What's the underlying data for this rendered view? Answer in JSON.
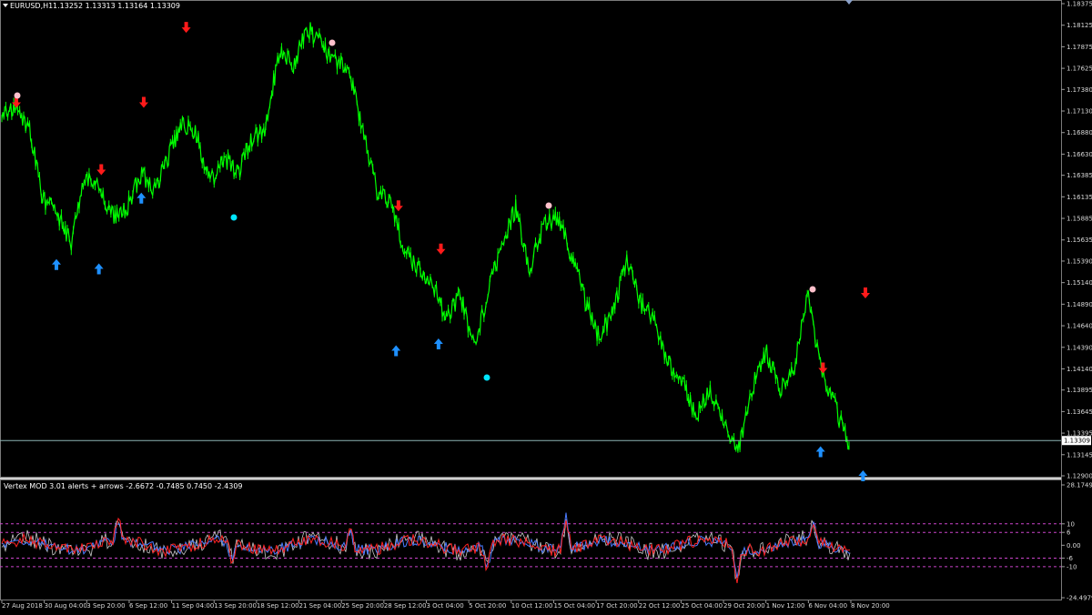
{
  "main_chart": {
    "title_symbol": "EURUSD,H1",
    "title_ohlc": "1.13252 1.13313 1.13164 1.13309",
    "price_ticks": [
      "1.18375",
      "1.18125",
      "1.17875",
      "1.17625",
      "1.17380",
      "1.17130",
      "1.16880",
      "1.16630",
      "1.16385",
      "1.16135",
      "1.15885",
      "1.15635",
      "1.15390",
      "1.15140",
      "1.14890",
      "1.14640",
      "1.14390",
      "1.14140",
      "1.13895",
      "1.13645",
      "1.13395",
      "1.13145",
      "1.12900"
    ],
    "current_price": "1.13309",
    "colors": {
      "price_line": "#00ff00",
      "buy_arrow": "#1e90ff",
      "sell_arrow": "#ff1a1a",
      "top_dot": "#ffc0cb",
      "bottom_dot": "#00e5ff",
      "current_line": "#8cb4b4"
    }
  },
  "indicator": {
    "title": "Vertex MOD 3.01 alerts + arrows -2.6672 -0.7485 0.7450 -2.4309",
    "scale_ticks": [
      "28.1749",
      "10",
      "6",
      "0.00",
      "-6",
      "-10",
      "-24.4979"
    ],
    "colors": {
      "level_lines": "#cc44cc",
      "fast": "#ff2222",
      "slow": "#4a7bff",
      "envelope": "#c8c8c8"
    }
  },
  "time_axis": [
    "27 Aug 2018",
    "30 Aug 04:00",
    "3 Sep 20:00",
    "6 Sep 12:00",
    "11 Sep 04:00",
    "13 Sep 20:00",
    "18 Sep 12:00",
    "21 Sep 04:00",
    "25 Sep 20:00",
    "28 Sep 12:00",
    "3 Oct 04:00",
    "5 Oct 20:00",
    "10 Oct 12:00",
    "15 Oct 04:00",
    "17 Oct 20:00",
    "22 Oct 12:00",
    "25 Oct 04:00",
    "29 Oct 20:00",
    "1 Nov 12:00",
    "6 Nov 04:00",
    "8 Nov 20:00"
  ],
  "chart_data": {
    "type": "line",
    "title": "EURUSD,H1",
    "x": [
      "27 Aug 2018",
      "30 Aug 04:00",
      "3 Sep 20:00",
      "6 Sep 12:00",
      "11 Sep 04:00",
      "13 Sep 20:00",
      "18 Sep 12:00",
      "21 Sep 04:00",
      "25 Sep 20:00",
      "28 Sep 12:00",
      "3 Oct 04:00",
      "5 Oct 20:00",
      "10 Oct 12:00",
      "15 Oct 04:00",
      "17 Oct 20:00",
      "22 Oct 12:00",
      "25 Oct 04:00",
      "29 Oct 20:00",
      "1 Nov 12:00",
      "6 Nov 04:00",
      "8 Nov 20:00"
    ],
    "ylim": [
      1.129,
      1.18375
    ],
    "series": [
      {
        "values": [
          1.1705,
          1.172,
          1.169,
          1.161,
          1.1595,
          1.156,
          1.164,
          1.1625,
          1.159,
          1.16,
          1.164,
          1.162,
          1.166,
          1.17,
          1.1685,
          1.163,
          1.166,
          1.164,
          1.168,
          1.1695,
          1.1785,
          1.1765,
          1.181,
          1.179,
          1.177,
          1.176,
          1.169,
          1.162,
          1.1605,
          1.155,
          1.153,
          1.1515,
          1.147,
          1.15,
          1.144,
          1.15,
          1.156,
          1.16,
          1.153,
          1.158,
          1.159,
          1.1545,
          1.1495,
          1.145,
          1.148,
          1.154,
          1.149,
          1.147,
          1.142,
          1.14,
          1.136,
          1.139,
          1.135,
          1.132,
          1.139,
          1.1435,
          1.139,
          1.141,
          1.15,
          1.141,
          1.137,
          1.1325
        ]
      }
    ]
  },
  "signals": {
    "buy": [
      [
        "27 Aug 2018",
        1.1535
      ],
      [
        "30 Aug 04:00",
        1.153
      ],
      [
        "3 Sep 20:00",
        1.1612
      ],
      [
        "25 Sep 20:00",
        1.1435
      ],
      [
        "28 Sep 12:00",
        1.1443
      ],
      [
        "1 Nov 12:00",
        1.1318
      ],
      [
        "6 Nov 04:00",
        1.129
      ]
    ],
    "sell": [
      [
        "27 Aug 2018",
        1.1723
      ],
      [
        "3 Sep 20:00",
        1.1645
      ],
      [
        "6 Sep 12:00",
        1.1723
      ],
      [
        "11 Sep 04:00",
        1.181
      ],
      [
        "28 Sep 12:00",
        1.1603
      ],
      [
        "3 Oct 04:00",
        1.1553
      ],
      [
        "6 Nov 04:00",
        1.1415
      ],
      [
        "8 Nov 20:00",
        1.1502
      ]
    ]
  }
}
